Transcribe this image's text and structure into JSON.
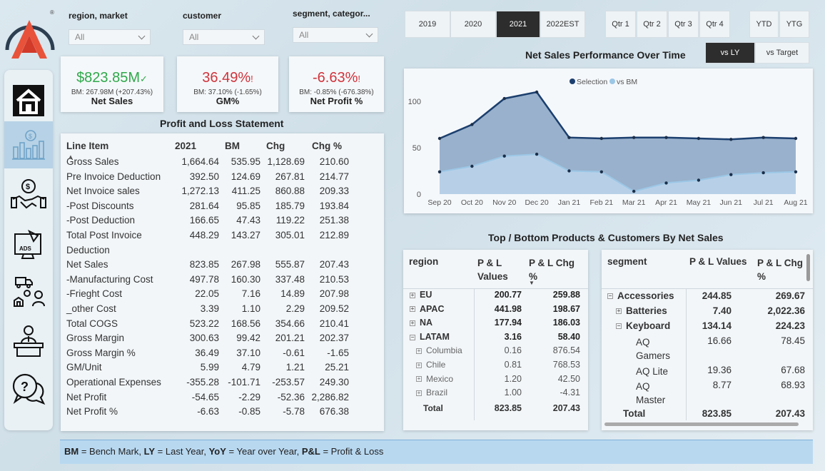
{
  "filters": [
    {
      "label": "region, market",
      "value": "All"
    },
    {
      "label": "customer",
      "value": "All"
    },
    {
      "label": "segment, categor...",
      "value": "All"
    }
  ],
  "years": [
    "2019",
    "2020",
    "2021",
    "2022EST"
  ],
  "selected_year": "2021",
  "quarters": [
    "Qtr 1",
    "Qtr 2",
    "Qtr 3",
    "Qtr 4"
  ],
  "period": [
    "YTD",
    "YTG"
  ],
  "kpis": [
    {
      "value": "$823.85M",
      "mark": "✓",
      "sub": "BM: 267.98M (+207.43%)",
      "label": "Net Sales",
      "color": "#2ea84a"
    },
    {
      "value": "36.49%",
      "mark": "!",
      "sub": "BM: 37.10% (-1.65%)",
      "label": "GM%",
      "color": "#d0333c"
    },
    {
      "value": "-6.63%",
      "mark": "!",
      "sub": "BM: -0.85% (-676.38%)",
      "label": "Net Profit %",
      "color": "#d0333c"
    }
  ],
  "pl": {
    "title": "Profit and Loss Statement",
    "headers": [
      "Line Item",
      "2021",
      "BM",
      "Chg",
      "Chg %"
    ],
    "rows": [
      [
        "Gross Sales",
        "1,664.64",
        "535.95",
        "1,128.69",
        "210.60"
      ],
      [
        "Pre Invoice Deduction",
        "392.50",
        "124.69",
        "267.81",
        "214.77"
      ],
      [
        "Net Invoice sales",
        "1,272.13",
        "411.25",
        "860.88",
        "209.33"
      ],
      [
        "-Post Discounts",
        "281.64",
        "95.85",
        "185.79",
        "193.84"
      ],
      [
        "-Post Deduction",
        "166.65",
        "47.43",
        "119.22",
        "251.38"
      ],
      [
        "Total Post Invoice",
        "448.29",
        "143.27",
        "305.01",
        "212.89"
      ],
      [
        "Deduction",
        "",
        "",
        "",
        ""
      ],
      [
        "Net Sales",
        "823.85",
        "267.98",
        "555.87",
        "207.43"
      ],
      [
        "-Manufacturing Cost",
        "497.78",
        "160.30",
        "337.48",
        "210.53"
      ],
      [
        "-Frieght Cost",
        "22.05",
        "7.16",
        "14.89",
        "207.98"
      ],
      [
        "_other Cost",
        "3.39",
        "1.10",
        "2.29",
        "209.52"
      ],
      [
        "Total COGS",
        "523.22",
        "168.56",
        "354.66",
        "210.41"
      ],
      [
        "Gross Margin",
        "300.63",
        "99.42",
        "201.21",
        "202.37"
      ],
      [
        "Gross Margin %",
        "36.49",
        "37.10",
        "-0.61",
        "-1.65"
      ],
      [
        "GM/Unit",
        "5.99",
        "4.79",
        "1.21",
        "25.21"
      ],
      [
        "Operational Expenses",
        "-355.28",
        "-101.71",
        "-253.57",
        "249.30"
      ],
      [
        "Net Profit",
        "-54.65",
        "-2.29",
        "-52.36",
        "2,286.82"
      ],
      [
        "Net Profit %",
        "-6.63",
        "-0.85",
        "-5.78",
        "676.38"
      ]
    ]
  },
  "chart_header": {
    "title": "Net Sales Performance Over Time",
    "toggle_on": "vs LY",
    "toggle_off": "vs Target"
  },
  "chart_data": {
    "type": "area",
    "title": "Net Sales Performance Over Time",
    "categories": [
      "Sep 20",
      "Oct 20",
      "Nov 20",
      "Dec 20",
      "Jan 21",
      "Feb 21",
      "Mar 21",
      "Apr 21",
      "May 21",
      "Jun 21",
      "Jul 21",
      "Aug 21"
    ],
    "series": [
      {
        "name": "Selection",
        "values": [
          60,
          75,
          103,
          110,
          61,
          60,
          61,
          61,
          60,
          59,
          61,
          60
        ],
        "color": "#1b3f6e"
      },
      {
        "name": "vs BM",
        "values": [
          24,
          30,
          41,
          43,
          25,
          24,
          3,
          12,
          15,
          21,
          23,
          24
        ],
        "color": "#9cc7e6"
      }
    ],
    "yticks": [
      0,
      50,
      100
    ],
    "ylim": [
      0,
      120
    ],
    "legend": "top-center",
    "grid": false
  },
  "topbottom_title": "Top / Bottom Products & Customers By Net Sales",
  "region_table": {
    "headers": [
      "region",
      "P & L Values",
      "P & L Chg %"
    ],
    "rows": [
      {
        "name": "EU",
        "v": "200.77",
        "c": "259.88",
        "lvl": 0,
        "exp": "+"
      },
      {
        "name": "APAC",
        "v": "441.98",
        "c": "198.67",
        "lvl": 0,
        "exp": "+"
      },
      {
        "name": "NA",
        "v": "177.94",
        "c": "186.03",
        "lvl": 0,
        "exp": "+"
      },
      {
        "name": "LATAM",
        "v": "3.16",
        "c": "58.40",
        "lvl": 0,
        "exp": "−"
      },
      {
        "name": "Columbia",
        "v": "0.16",
        "c": "876.54",
        "lvl": 1,
        "exp": "+"
      },
      {
        "name": "Chile",
        "v": "0.81",
        "c": "768.53",
        "lvl": 1,
        "exp": "+"
      },
      {
        "name": "Mexico",
        "v": "1.20",
        "c": "42.50",
        "lvl": 1,
        "exp": "+"
      },
      {
        "name": "Brazil",
        "v": "1.00",
        "c": "-4.31",
        "lvl": 1,
        "exp": "+"
      }
    ],
    "total": {
      "name": "Total",
      "v": "823.85",
      "c": "207.43"
    }
  },
  "segment_table": {
    "headers": [
      "segment",
      "P & L Values",
      "P & L Chg %"
    ],
    "rows": [
      {
        "name": "Accessories",
        "v": "244.85",
        "c": "269.67",
        "lvl": 0,
        "exp": "−"
      },
      {
        "name": "Batteries",
        "v": "7.40",
        "c": "2,022.36",
        "lvl": 1,
        "exp": "+"
      },
      {
        "name": "Keyboard",
        "v": "134.14",
        "c": "224.23",
        "lvl": 1,
        "exp": "−"
      },
      {
        "name": "AQ Gamers",
        "v": "16.66",
        "c": "78.45",
        "lvl": 2,
        "exp": ""
      },
      {
        "name": "AQ Lite",
        "v": "19.36",
        "c": "67.68",
        "lvl": 2,
        "exp": ""
      },
      {
        "name": "AQ Master",
        "v": "8.77",
        "c": "68.93",
        "lvl": 2,
        "exp": ""
      }
    ],
    "total": {
      "name": "Total",
      "v": "823.85",
      "c": "207.43"
    }
  },
  "footer": [
    {
      "b": "BM",
      "t": " = Bench Mark, "
    },
    {
      "b": "LY",
      "t": " = Last Year, "
    },
    {
      "b": "YoY",
      "t": " = Year over Year, "
    },
    {
      "b": "P&L",
      "t": " = Profit & Loss"
    }
  ]
}
